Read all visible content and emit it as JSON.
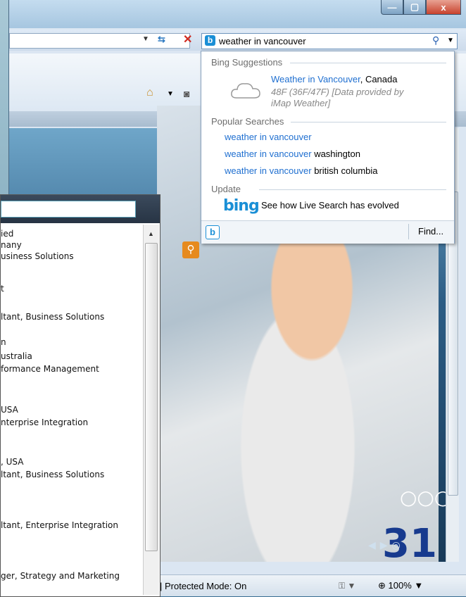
{
  "window_controls": {
    "minimize": "—",
    "maximize": "▢",
    "close": "x"
  },
  "search": {
    "value": "weather in vancouver"
  },
  "suggestions": {
    "bing_header": "Bing Suggestions",
    "weather_link": "Weather in Vancouver",
    "weather_country": ", Canada",
    "weather_detail": "48F (36F/47F) [Data provided by iMap Weather]",
    "popular_header": "Popular Searches",
    "popular": [
      {
        "link": "weather in vancouver",
        "extra": ""
      },
      {
        "link": "weather in vancouver",
        "extra": " washington"
      },
      {
        "link": "weather in vancouver",
        "extra": " british columbia"
      }
    ],
    "update_header": "Update",
    "bing_logo": "bing",
    "bing_text": "See how Live Search has evolved",
    "find": "Find..."
  },
  "status": {
    "protected": "| Protected Mode: On",
    "zoom": "100%"
  },
  "photo": {
    "bib": "31"
  },
  "left_list": [
    "ied",
    "nany",
    "usiness Solutions",
    "t",
    "ltant, Business Solutions",
    "n",
    "ustralia",
    "formance Management",
    "USA",
    "nterprise Integration",
    ", USA",
    "ltant, Business Solutions",
    "ltant, Enterprise Integration",
    "ger, Strategy and Marketing"
  ]
}
